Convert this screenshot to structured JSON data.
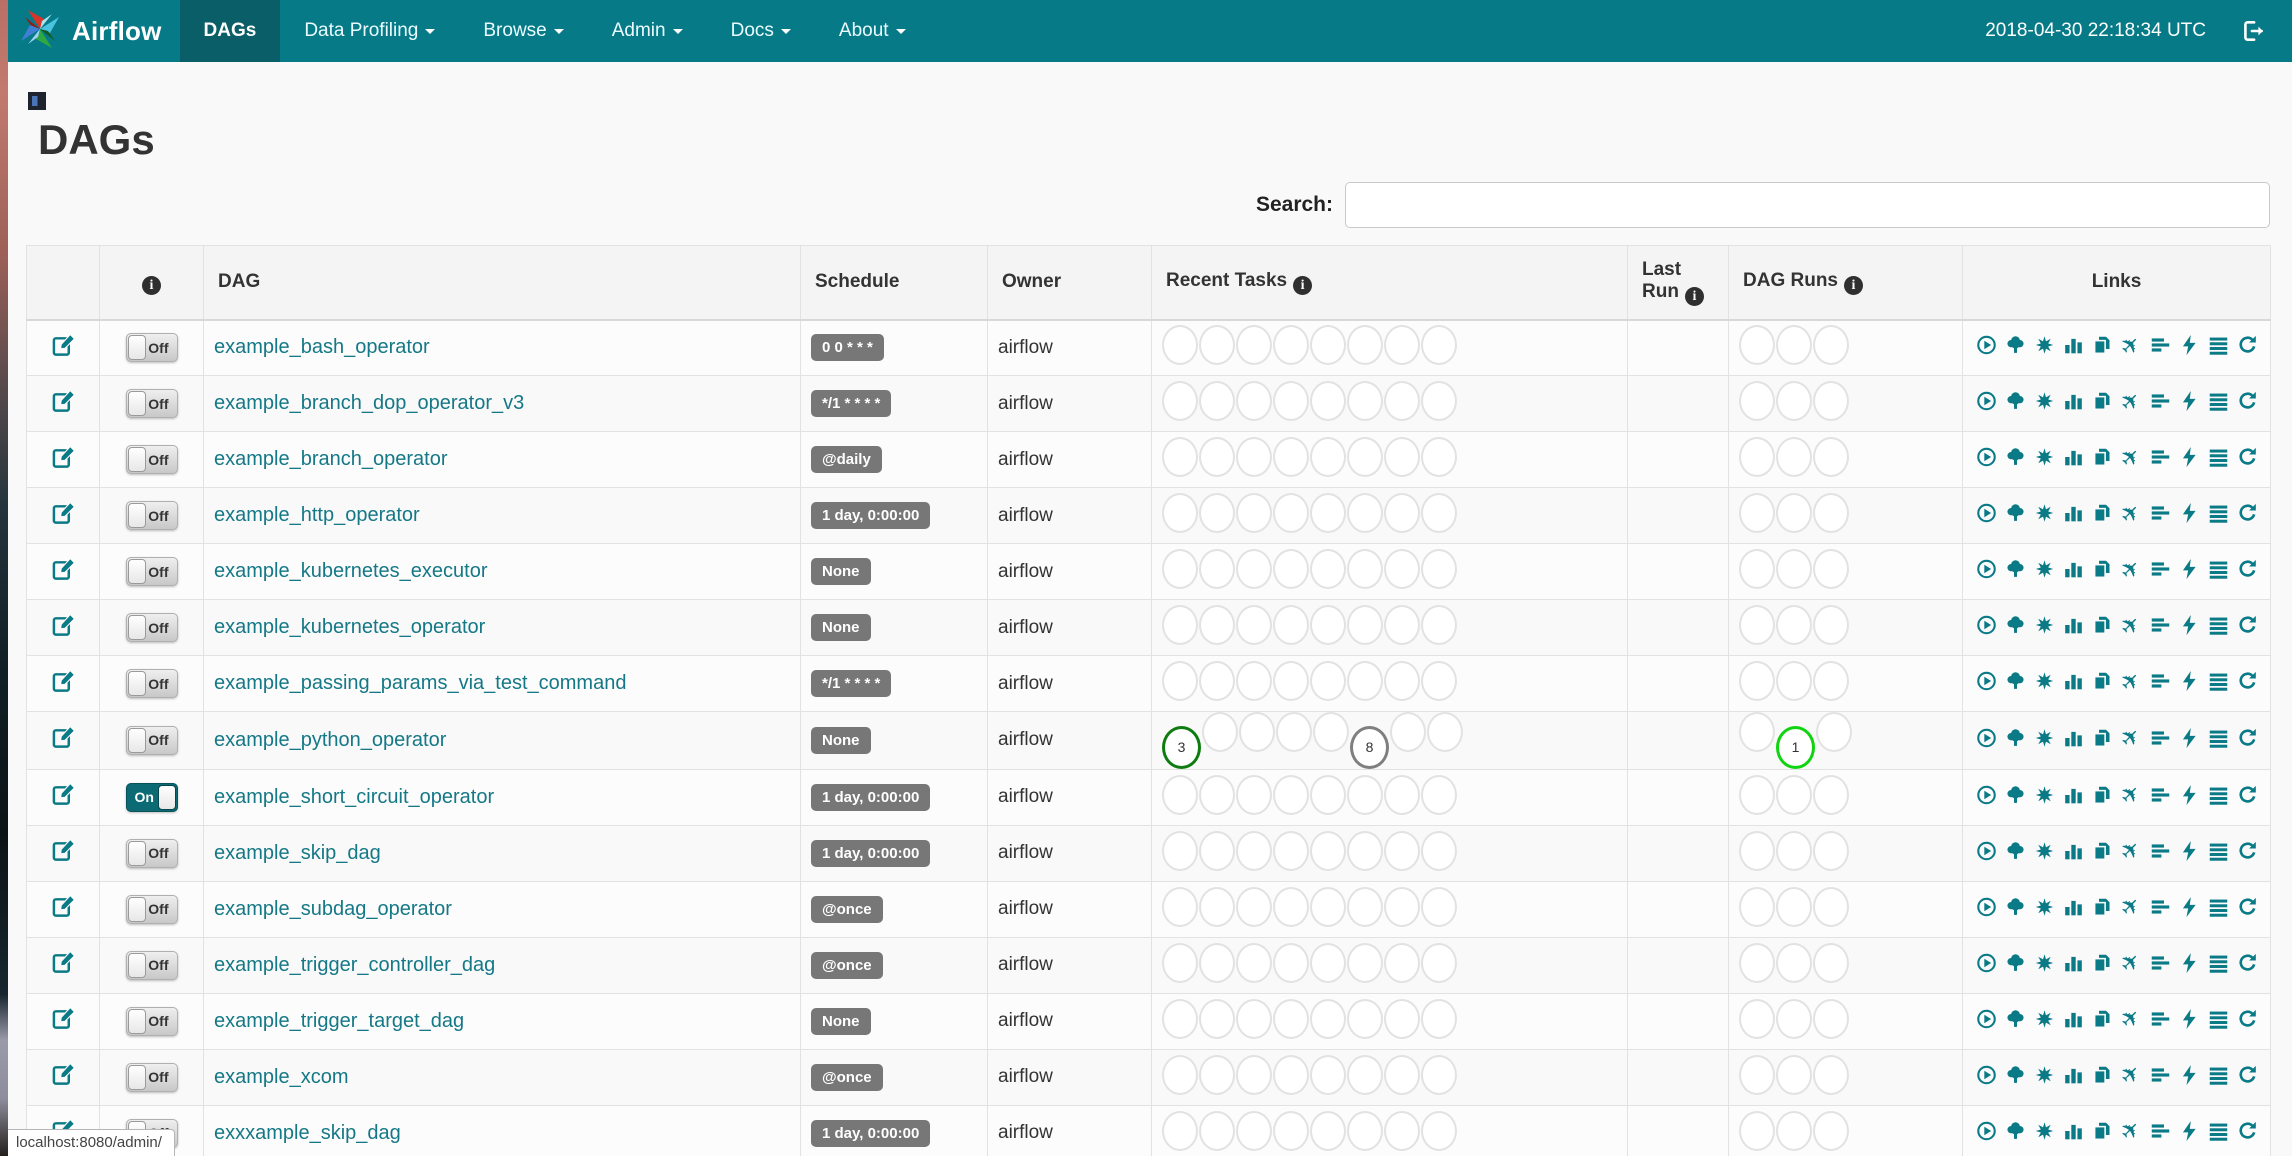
{
  "navbar": {
    "brand": "Airflow",
    "items": [
      {
        "label": "DAGs",
        "active": true,
        "caret": false
      },
      {
        "label": "Data Profiling",
        "active": false,
        "caret": true
      },
      {
        "label": "Browse",
        "active": false,
        "caret": true
      },
      {
        "label": "Admin",
        "active": false,
        "caret": true
      },
      {
        "label": "Docs",
        "active": false,
        "caret": true
      },
      {
        "label": "About",
        "active": false,
        "caret": true
      }
    ],
    "clock": "2018-04-30 22:18:34 UTC"
  },
  "page": {
    "title": "DAGs",
    "search_label": "Search:",
    "search_value": "",
    "status_bar": "localhost:8080/admin/"
  },
  "table": {
    "headers": {
      "dag": "DAG",
      "schedule": "Schedule",
      "owner": "Owner",
      "recent_tasks": "Recent Tasks",
      "last_run": "Last Run",
      "dag_runs": "DAG Runs",
      "links": "Links"
    },
    "toggle": {
      "on_label": "On",
      "off_label": "Off"
    },
    "recent_task_slots": 8,
    "dag_run_slots": 3,
    "link_icon_names": [
      "trigger-dag-icon",
      "tree-view-icon",
      "graph-view-icon",
      "task-duration-icon",
      "task-tries-icon",
      "landing-times-icon",
      "gantt-view-icon",
      "code-view-icon",
      "logs-icon",
      "refresh-icon"
    ],
    "rows": [
      {
        "dag": "example_bash_operator",
        "enabled": false,
        "schedule": "0 0 * * *",
        "owner": "airflow",
        "recent_tasks": [],
        "dag_runs": []
      },
      {
        "dag": "example_branch_dop_operator_v3",
        "enabled": false,
        "schedule": "*/1 * * * *",
        "owner": "airflow",
        "recent_tasks": [],
        "dag_runs": []
      },
      {
        "dag": "example_branch_operator",
        "enabled": false,
        "schedule": "@daily",
        "owner": "airflow",
        "recent_tasks": [],
        "dag_runs": []
      },
      {
        "dag": "example_http_operator",
        "enabled": false,
        "schedule": "1 day, 0:00:00",
        "owner": "airflow",
        "recent_tasks": [],
        "dag_runs": []
      },
      {
        "dag": "example_kubernetes_executor",
        "enabled": false,
        "schedule": "None",
        "owner": "airflow",
        "recent_tasks": [],
        "dag_runs": []
      },
      {
        "dag": "example_kubernetes_operator",
        "enabled": false,
        "schedule": "None",
        "owner": "airflow",
        "recent_tasks": [],
        "dag_runs": []
      },
      {
        "dag": "example_passing_params_via_test_command",
        "enabled": false,
        "schedule": "*/1 * * * *",
        "owner": "airflow",
        "recent_tasks": [],
        "dag_runs": []
      },
      {
        "dag": "example_python_operator",
        "enabled": false,
        "schedule": "None",
        "owner": "airflow",
        "recent_tasks": [
          {
            "slot": 0,
            "count": 3,
            "color": "#0f7c12"
          },
          {
            "slot": 5,
            "count": 8,
            "color": "#7f7f7f"
          }
        ],
        "dag_runs": [
          {
            "slot": 1,
            "count": 1,
            "color": "#11d411"
          }
        ]
      },
      {
        "dag": "example_short_circuit_operator",
        "enabled": true,
        "schedule": "1 day, 0:00:00",
        "owner": "airflow",
        "recent_tasks": [],
        "dag_runs": []
      },
      {
        "dag": "example_skip_dag",
        "enabled": false,
        "schedule": "1 day, 0:00:00",
        "owner": "airflow",
        "recent_tasks": [],
        "dag_runs": []
      },
      {
        "dag": "example_subdag_operator",
        "enabled": false,
        "schedule": "@once",
        "owner": "airflow",
        "recent_tasks": [],
        "dag_runs": []
      },
      {
        "dag": "example_trigger_controller_dag",
        "enabled": false,
        "schedule": "@once",
        "owner": "airflow",
        "recent_tasks": [],
        "dag_runs": []
      },
      {
        "dag": "example_trigger_target_dag",
        "enabled": false,
        "schedule": "None",
        "owner": "airflow",
        "recent_tasks": [],
        "dag_runs": []
      },
      {
        "dag": "example_xcom",
        "enabled": false,
        "schedule": "@once",
        "owner": "airflow",
        "recent_tasks": [],
        "dag_runs": []
      },
      {
        "dag": "exxxample_skip_dag",
        "enabled": false,
        "schedule": "1 day, 0:00:00",
        "owner": "airflow",
        "recent_tasks": [],
        "dag_runs": []
      }
    ]
  },
  "colors": {
    "navbar": "#077a87",
    "navbar_active": "#0a5e68",
    "link_teal": "#157886",
    "icon_teal": "#0b7a87",
    "badge_gray": "#777777",
    "success_green": "#0f7c12",
    "running_green": "#11d411",
    "skipped_gray": "#7f7f7f"
  }
}
